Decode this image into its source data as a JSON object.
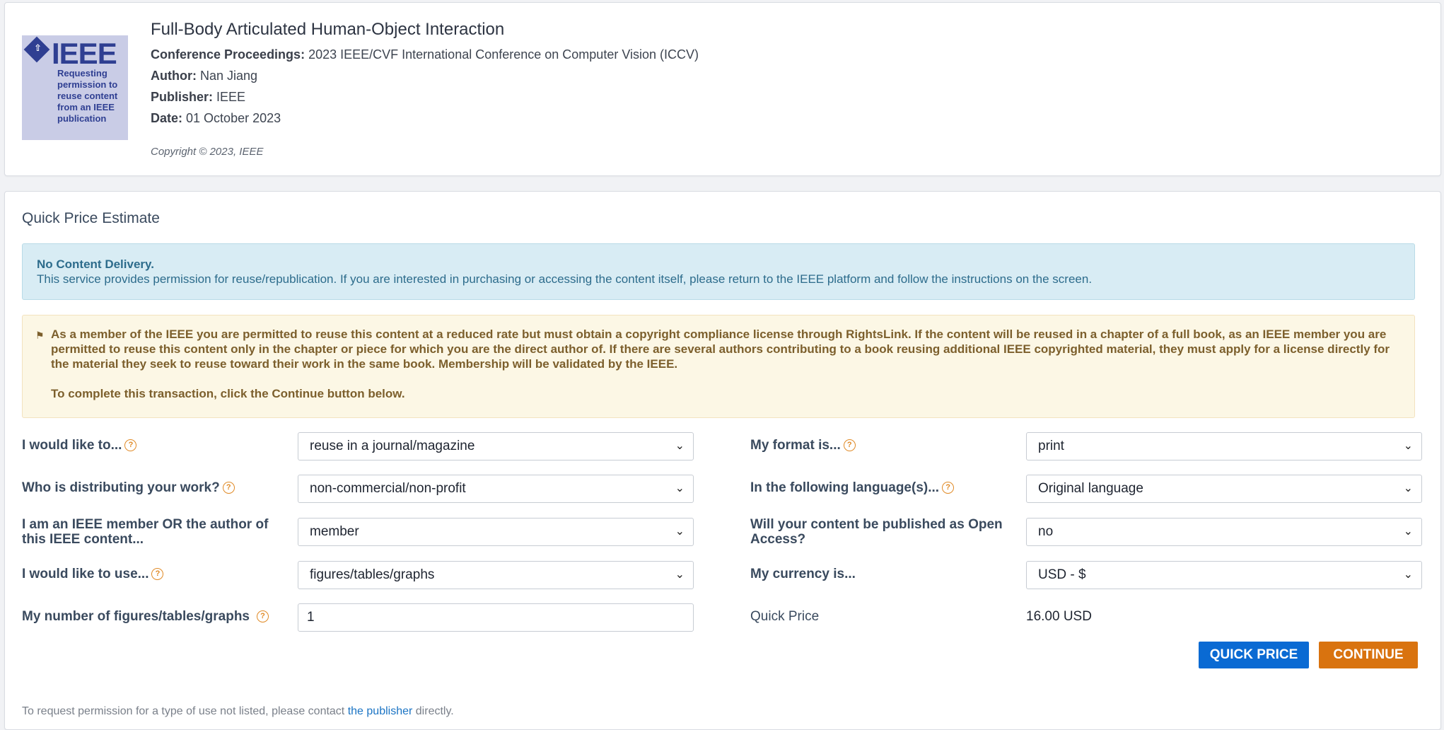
{
  "publication": {
    "logo_word": "IEEE",
    "logo_text": "Requesting permission to reuse content from an IEEE publication",
    "title": "Full-Body Articulated Human-Object Interaction",
    "proceedings_label": "Conference Proceedings:",
    "proceedings_value": "2023 IEEE/CVF International Conference on Computer Vision (ICCV)",
    "author_label": "Author:",
    "author_value": "Nan Jiang",
    "publisher_label": "Publisher:",
    "publisher_value": "IEEE",
    "date_label": "Date:",
    "date_value": "01 October 2023",
    "copyright": "Copyright © 2023, IEEE"
  },
  "estimate": {
    "section_title": "Quick Price Estimate",
    "info_title": "No Content Delivery.",
    "info_body": "This service provides permission for reuse/republication. If you are interested in purchasing or accessing the content itself, please return to the IEEE platform and follow the instructions on the screen.",
    "warn_body": "As a member of the IEEE you are permitted to reuse this content at a reduced rate but must obtain a copyright compliance license through RightsLink. If the content will be reused in a chapter of a full book, as an IEEE member you are permitted to reuse this content only in the chapter or piece for which you are the direct author of. If there are several authors contributing to a book reusing additional IEEE copyrighted material, they must apply for a license directly for the material they seek to reuse toward their work in the same book. Membership will be validated by the IEEE.",
    "warn_cta": "To complete this transaction, click the Continue button below."
  },
  "form": {
    "use_type_label": "I would like to...",
    "use_type_value": "reuse in a journal/magazine",
    "distributor_label": "Who is distributing your work?",
    "distributor_value": "non-commercial/non-profit",
    "member_label": "I am an IEEE member OR the author of this IEEE content...",
    "member_value": "member",
    "portion_label": "I would like to use...",
    "portion_value": "figures/tables/graphs",
    "count_label": "My number of figures/tables/graphs",
    "count_value": "1",
    "format_label": "My format is...",
    "format_value": "print",
    "language_label": "In the following language(s)...",
    "language_value": "Original language",
    "open_access_label": "Will your content be published as Open Access?",
    "open_access_value": "no",
    "currency_label": "My currency is...",
    "currency_value": "USD - $",
    "quick_price_label": "Quick Price",
    "quick_price_value": "16.00 USD"
  },
  "buttons": {
    "quick_price": "QUICK PRICE",
    "continue": "CONTINUE"
  },
  "footer": {
    "prefix": "To request permission for a type of use not listed, please contact",
    "link": "the publisher",
    "suffix": "directly."
  },
  "colors": {
    "primary_button": "#0a6ad3",
    "continue_button": "#d9730f",
    "info_bg": "#d8ecf4",
    "warning_bg": "#fcf7e5",
    "help_icon": "#e08a26"
  }
}
